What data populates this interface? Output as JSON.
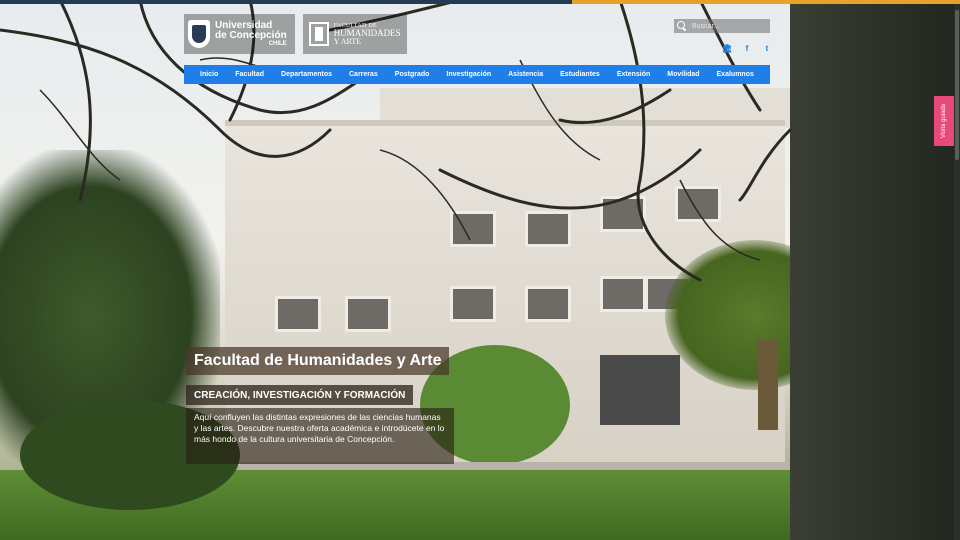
{
  "header": {
    "university_logo": {
      "line1": "Universidad",
      "line2": "de Concepción",
      "line3": "CHILE"
    },
    "faculty_logo": {
      "line1": "FACULTAD DE",
      "line2": "HUMANIDADES",
      "line3": "Y ARTE"
    },
    "search": {
      "placeholder": "Buscar..."
    },
    "social": [
      {
        "icon": "institution-icon",
        "glyph": "🏛"
      },
      {
        "icon": "facebook-icon",
        "glyph": "f"
      },
      {
        "icon": "twitter-icon",
        "glyph": "t"
      }
    ]
  },
  "nav": {
    "items": [
      "Inicio",
      "Facultad",
      "Departamentos",
      "Carreras",
      "Postgrado",
      "Investigación",
      "Asistencia",
      "Estudiantes",
      "Extensión",
      "Movilidad",
      "Exalumnos"
    ]
  },
  "side_tab": {
    "label": "Visita guiada"
  },
  "hero": {
    "title": "Facultad de Humanidades y Arte",
    "subtitle": "CREACIÓN, INVESTIGACIÓN Y FORMACIÓN",
    "body": "Aquí confluyen las distintas expresiones de las ciencias humanas y las artes. Descubre nuestra oferta académica e introdúcete en lo más hondo de la cultura universitaria de Concepción."
  },
  "colors": {
    "nav_bg": "#1f7ee8",
    "side_tab": "#e64a7a",
    "top_accent": "#e8a22a",
    "social_icons": "#1e7fe0"
  }
}
